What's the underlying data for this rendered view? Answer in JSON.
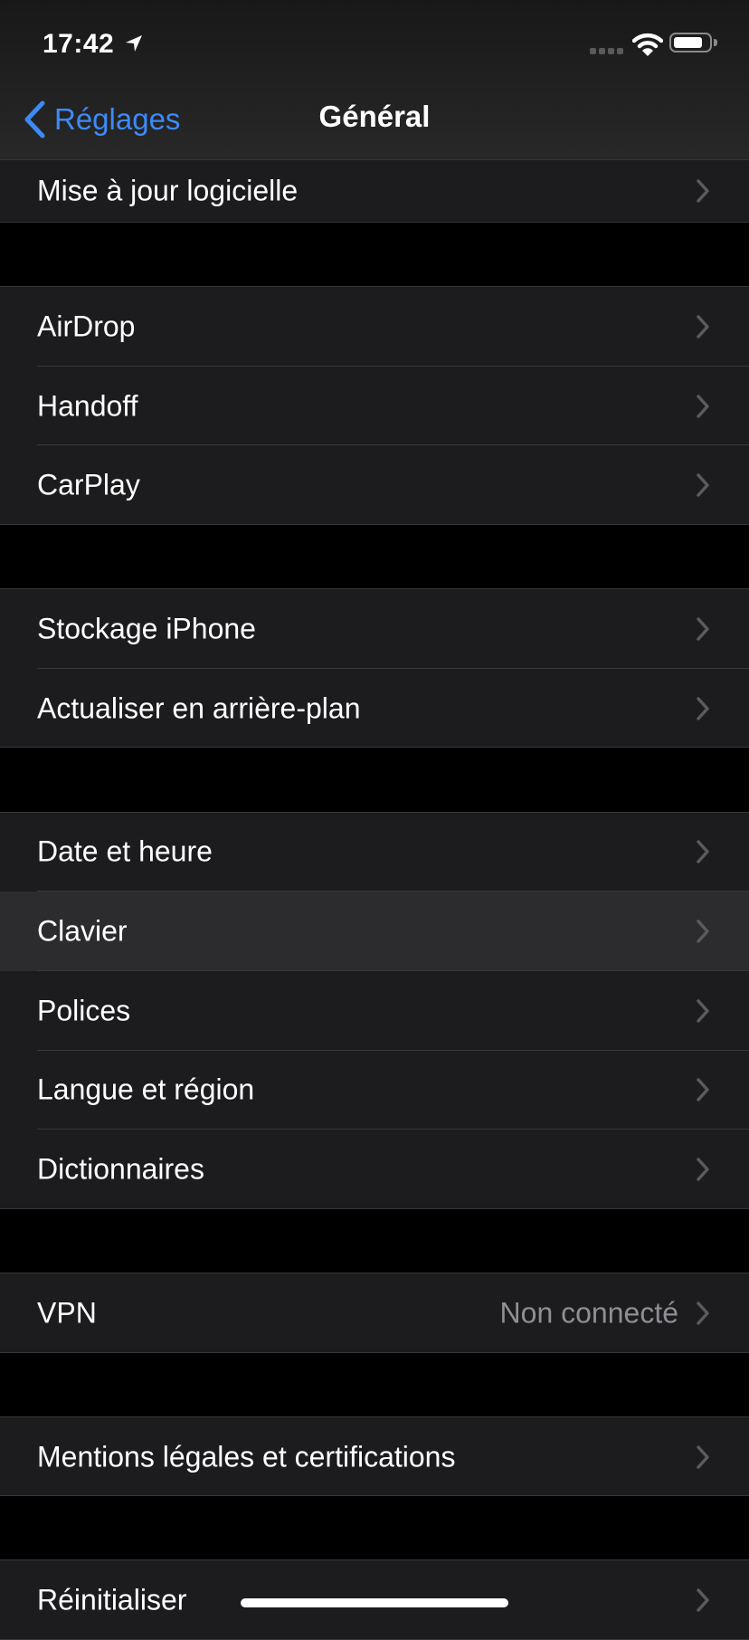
{
  "status_bar": {
    "time": "17:42",
    "location_icon": "location-arrow-icon",
    "signal_icon": "cellular-no-signal-icon",
    "wifi_icon": "wifi-icon",
    "battery_icon": "battery-icon",
    "battery_level_percent": 85
  },
  "nav": {
    "back_label": "Réglages",
    "back_icon": "chevron-left-icon",
    "title": "Général"
  },
  "colors": {
    "accent": "#3d8af7",
    "row_bg": "#1c1c1e",
    "row_highlight": "#2c2c2e",
    "separator": "#38383a",
    "secondary_text": "#8e8e93",
    "chevron": "#5b5b5f"
  },
  "groups": [
    {
      "items": [
        {
          "label": "Mise à jour logicielle"
        }
      ]
    },
    {
      "items": [
        {
          "label": "AirDrop"
        },
        {
          "label": "Handoff"
        },
        {
          "label": "CarPlay"
        }
      ]
    },
    {
      "items": [
        {
          "label": "Stockage iPhone"
        },
        {
          "label": "Actualiser en arrière-plan"
        }
      ]
    },
    {
      "items": [
        {
          "label": "Date et heure"
        },
        {
          "label": "Clavier",
          "highlighted": true
        },
        {
          "label": "Polices"
        },
        {
          "label": "Langue et région"
        },
        {
          "label": "Dictionnaires"
        }
      ]
    },
    {
      "items": [
        {
          "label": "VPN",
          "value": "Non connecté"
        }
      ]
    },
    {
      "items": [
        {
          "label": "Mentions légales et certifications"
        }
      ]
    },
    {
      "items": [
        {
          "label": "Réinitialiser"
        }
      ]
    }
  ]
}
